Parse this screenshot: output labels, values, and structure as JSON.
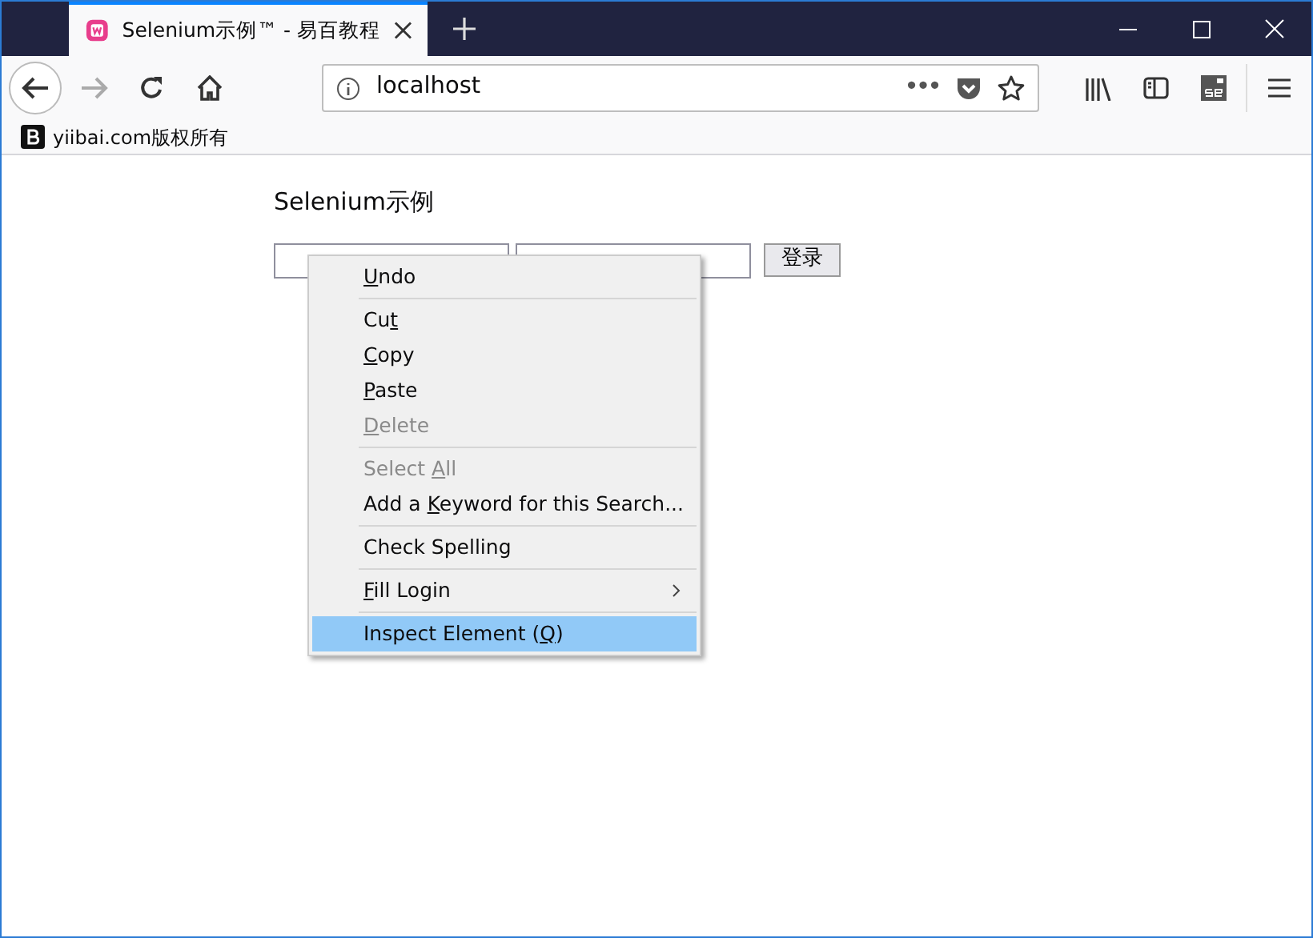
{
  "window": {
    "tab_title": "Selenium示例™ - 易百教程"
  },
  "toolbar": {
    "address": "localhost",
    "page_actions": "•••"
  },
  "bookmarks": [
    {
      "label": "yiibai.com版权所有"
    }
  ],
  "page": {
    "heading": "Selenium示例",
    "submit_button": "登录"
  },
  "context_menu": [
    {
      "kind": "item",
      "mnemonic": "U",
      "after": "ndo",
      "disabled": false,
      "selected": false
    },
    {
      "kind": "separator"
    },
    {
      "kind": "item",
      "before": "Cu",
      "mnemonic": "t",
      "disabled": false,
      "selected": false
    },
    {
      "kind": "item",
      "mnemonic": "C",
      "after": "opy",
      "disabled": false,
      "selected": false
    },
    {
      "kind": "item",
      "mnemonic": "P",
      "after": "aste",
      "disabled": false,
      "selected": false
    },
    {
      "kind": "item",
      "mnemonic": "D",
      "after": "elete",
      "disabled": true,
      "selected": false
    },
    {
      "kind": "separator"
    },
    {
      "kind": "item",
      "before": "Select ",
      "mnemonic": "A",
      "after": "ll",
      "disabled": true,
      "selected": false
    },
    {
      "kind": "item",
      "before": "Add a ",
      "mnemonic": "K",
      "after": "eyword for this Search...",
      "disabled": false,
      "selected": false
    },
    {
      "kind": "separator"
    },
    {
      "kind": "item",
      "before": "Check Spelling",
      "disabled": false,
      "selected": false
    },
    {
      "kind": "separator"
    },
    {
      "kind": "item",
      "mnemonic": "F",
      "after": "ill Login",
      "disabled": false,
      "selected": false,
      "submenu": true
    },
    {
      "kind": "separator"
    },
    {
      "kind": "item",
      "before": "Inspect Element (",
      "mnemonic": "Q",
      "after": ")",
      "disabled": false,
      "selected": true
    }
  ]
}
